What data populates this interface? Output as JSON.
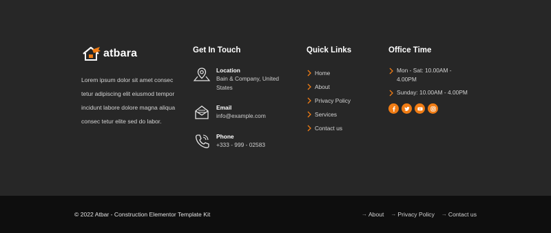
{
  "brand": {
    "name": "atbara",
    "logo_icon": "house-wrench-icon"
  },
  "about": {
    "text": "Lorem ipsum dolor sit amet consec tetur adipiscing elit eiusmod tempor incidunt labore dolore magna aliqua consec tetur elite sed do labor."
  },
  "contact": {
    "title": "Get In Touch",
    "items": [
      {
        "icon": "map-pin-icon",
        "label": "Location",
        "value": "Bain & Company, United States"
      },
      {
        "icon": "envelope-icon",
        "label": "Email",
        "value": "info@example.com"
      },
      {
        "icon": "phone-icon",
        "label": "Phone",
        "value": "+333 - 999 - 02583"
      }
    ]
  },
  "quick_links": {
    "title": "Quick Links",
    "items": [
      "Home",
      "About",
      "Privacy Policy",
      "Services",
      "Contact us"
    ]
  },
  "office": {
    "title": "Office Time",
    "hours": [
      "Mon - Sat: 10.00AM - 4.00PM",
      "Sunday: 10.00AM - 4.00PM"
    ],
    "socials": [
      "facebook-icon",
      "twitter-icon",
      "youtube-icon",
      "instagram-icon"
    ]
  },
  "bottom": {
    "copyright": "© 2022 Atbar - Construction Elementor Template Kit",
    "links": [
      "About",
      "Privacy Policy",
      "Contact us"
    ]
  },
  "colors": {
    "accent": "#f07c14",
    "bg": "#272727",
    "bottom_bg": "#0e0e0e"
  }
}
